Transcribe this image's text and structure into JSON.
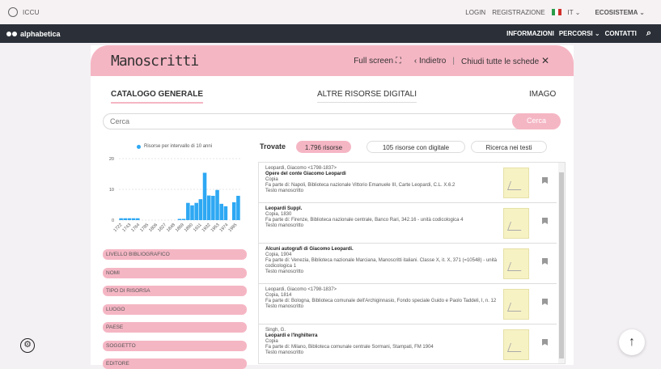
{
  "topbar": {
    "brand": "ICCU",
    "login": "LOGIN",
    "register": "REGISTRAZIONE",
    "lang": "IT",
    "ecosistema": "ECOSISTEMA"
  },
  "nav": {
    "brand": "alphabetica",
    "items": [
      "INFORMAZIONI",
      "PERCORSI",
      "CONTATTI"
    ]
  },
  "panel": {
    "title": "Manoscritti",
    "fullscreen": "Full screen",
    "back": "Indietro",
    "close_all": "Chiudi tutte le schede"
  },
  "tabs": [
    "CATALOGO GENERALE",
    "ALTRE RISORSE DIGITALI",
    "IMAGO"
  ],
  "search": {
    "placeholder": "Cerca",
    "button": "Cerca"
  },
  "chart_data": {
    "type": "bar",
    "legend": "Risorse per intervallo di 10 anni",
    "ylim": [
      0,
      20
    ],
    "yticks": [
      0,
      10,
      20
    ],
    "xticklabels": [
      "1722",
      "1743",
      "1764",
      "1785",
      "1806",
      "1827",
      "1848",
      "1869",
      "1890",
      "1911",
      "1932",
      "1953",
      "1974",
      "1995"
    ],
    "categories": [
      "1715",
      "1725",
      "1735",
      "1745",
      "1755",
      "1765",
      "1775",
      "1785",
      "1795",
      "1805",
      "1815",
      "1825",
      "1835",
      "1845",
      "1855",
      "1865",
      "1875",
      "1885",
      "1895",
      "1905",
      "1915",
      "1925",
      "1935",
      "1945",
      "1955",
      "1965",
      "1975",
      "1985",
      "1995"
    ],
    "values": [
      0.6,
      0.6,
      0.6,
      0.6,
      0.6,
      0.0,
      0.0,
      0.0,
      0.0,
      0.0,
      0.0,
      0.0,
      0.0,
      0.0,
      0.4,
      0.4,
      5.6,
      4.8,
      5.6,
      6.8,
      15.4,
      8.0,
      7.9,
      9.8,
      5.3,
      4.5,
      0.0,
      5.8,
      7.9
    ],
    "color": "#2ea8f3"
  },
  "facets": [
    "LIVELLO BIBLIOGRAFICO",
    "NOMI",
    "TIPO DI RISORSA",
    "LUOGO",
    "PAESE",
    "SOGGETTO",
    "EDITORE"
  ],
  "results": {
    "label": "Trovate",
    "pills": [
      "1.796 risorse",
      "105 risorse con digitale",
      "Ricerca nei testi"
    ],
    "items": [
      {
        "l1": "Leopardi, Giacomo <1798-1837>",
        "title": "Opere del conte Giacomo Leopardi",
        "l2": "Copia",
        "l3": "Fa parte di: Napoli, Biblioteca nazionale Vittorio Emanuele III, Carte Leopardi, C.L. X.6.2",
        "l4": "Testo manoscritto"
      },
      {
        "l1": "",
        "title": "Leopardi Suppl.",
        "l2": "Copia, 1830",
        "l3": "Fa parte di: Firenze, Biblioteca nazionale centrale, Banco Rari, 342.16 - unità codicologica 4",
        "l4": "Testo manoscritto"
      },
      {
        "l1": "",
        "title": "Alcuni autografi di Giacomo Leopardi.",
        "l2": "Copia, 1904",
        "l3": "Fa parte di: Venezia, Biblioteca nazionale Marciana, Manoscritti italiani. Classe X, it. X, 371 (=10548) - unità codicologica 1",
        "l4": "Testo manoscritto"
      },
      {
        "l1": "Leopardi, Giacomo <1798-1837>",
        "title": "",
        "l2": "Copia, 1814",
        "l3": "Fa parte di: Bologna, Biblioteca comunale dell'Archiginnasio, Fondo speciale Guido e Paolo Taddeli, I, n. 12",
        "l4": "Testo manoscritto"
      },
      {
        "l1": "Singh, G.",
        "title": "Leopardi e l'Inghilterra",
        "l2": "Copia",
        "l3": "Fa parte di: Milano, Biblioteca comunale centrale Sormani, Stampati, FM 1904",
        "l4": "Testo manoscritto"
      }
    ]
  }
}
